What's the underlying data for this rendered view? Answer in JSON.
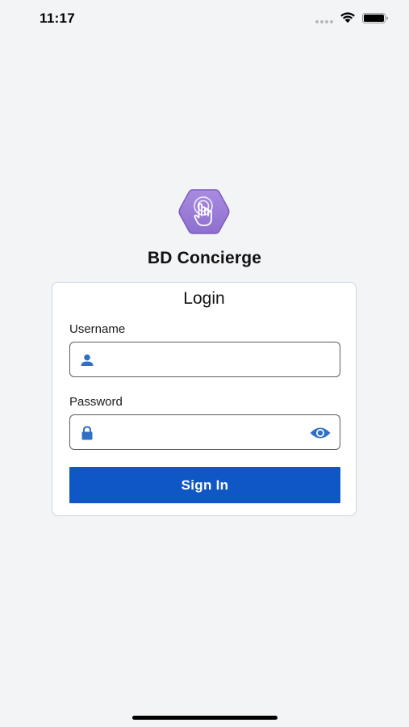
{
  "status_bar": {
    "time": "11:17",
    "icons": [
      "signal-dots-icon",
      "wifi-icon",
      "battery-icon"
    ]
  },
  "app": {
    "logo_icon": "hand-tap-hexagon-icon",
    "title": "BD Concierge"
  },
  "login_card": {
    "title": "Login",
    "username": {
      "label": "Username",
      "value": "",
      "placeholder": "",
      "icon": "person-icon"
    },
    "password": {
      "label": "Password",
      "value": "",
      "placeholder": "",
      "icon": "lock-icon",
      "toggle_icon": "eye-icon"
    },
    "submit_label": "Sign In"
  },
  "colors": {
    "background": "#f3f4f6",
    "accent": "#1057c6",
    "logo": "#9b7fd6",
    "icon": "#2f6fc4"
  }
}
